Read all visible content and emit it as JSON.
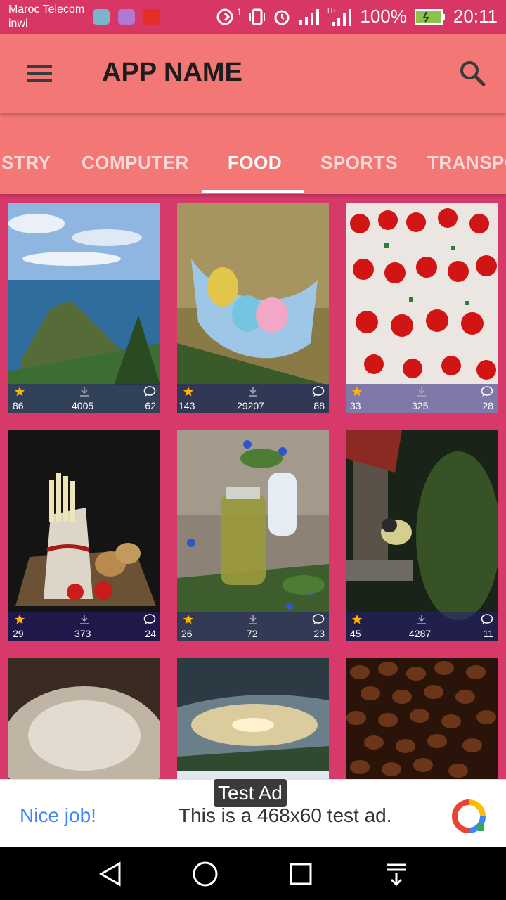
{
  "status_bar": {
    "carrier_1": "Maroc Telecom",
    "carrier_2": "inwi",
    "notification_count": "1",
    "battery": "100%",
    "time": "20:11"
  },
  "toolbar": {
    "title": "APP NAME",
    "menu_icon": "hamburger-menu-icon",
    "search_icon": "search-icon"
  },
  "tabs": [
    {
      "label": "STRY",
      "active": false
    },
    {
      "label": "COMPUTER",
      "active": false
    },
    {
      "label": "FOOD",
      "active": true
    },
    {
      "label": "SPORTS",
      "active": false
    },
    {
      "label": "TRANSPO",
      "active": false
    }
  ],
  "grid": [
    {
      "subject": "coastal island",
      "likes": "86",
      "downloads": "4005",
      "comments": "62"
    },
    {
      "subject": "eggs in face mask",
      "likes": "143",
      "downloads": "29207",
      "comments": "88"
    },
    {
      "subject": "strawberries in boxes",
      "likes": "33",
      "downloads": "325",
      "comments": "28"
    },
    {
      "subject": "asparagus and potatoes",
      "likes": "29",
      "downloads": "373",
      "comments": "24"
    },
    {
      "subject": "oil jar with flowers",
      "likes": "26",
      "downloads": "72",
      "comments": "23"
    },
    {
      "subject": "bird on feeder",
      "likes": "45",
      "downloads": "4287",
      "comments": "11"
    },
    {
      "subject": "blurred white",
      "likes": "",
      "downloads": "",
      "comments": ""
    },
    {
      "subject": "sky over lake",
      "likes": "",
      "downloads": "",
      "comments": ""
    },
    {
      "subject": "coffee beans",
      "likes": "",
      "downloads": "",
      "comments": ""
    }
  ],
  "ad": {
    "badge": "Test Ad",
    "headline": "Nice job!",
    "text": "This is a 468x60 test ad."
  },
  "colors": {
    "accent": "#f27775",
    "background": "#d73a6a",
    "status_bar": "#d83765"
  }
}
